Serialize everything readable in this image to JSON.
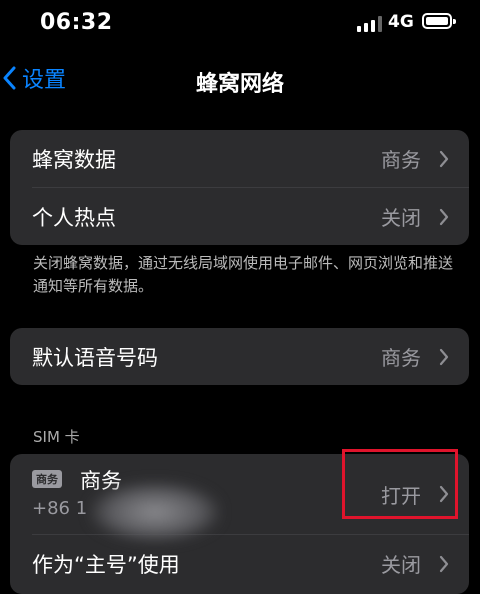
{
  "status_bar": {
    "time": "06:32",
    "network": "4G"
  },
  "nav": {
    "back_label": "设置",
    "title": "蜂窝网络"
  },
  "group1": {
    "rows": [
      {
        "label": "蜂窝数据",
        "value": "商务"
      },
      {
        "label": "个人热点",
        "value": "关闭"
      }
    ]
  },
  "footnote": "关闭蜂窝数据，通过无线局域网使用电子邮件、网页浏览和推送通知等所有数据。",
  "group2": {
    "rows": [
      {
        "label": "默认语音号码",
        "value": "商务"
      }
    ]
  },
  "sim_section": {
    "header": "SIM 卡",
    "sim": {
      "badge": "商务",
      "name": "商务",
      "number": "+86 1",
      "value": "打开"
    },
    "primary_row": {
      "label": "作为“主号”使用",
      "value": "关闭"
    }
  },
  "colors": {
    "accent": "#0a84ff",
    "highlight": "#e0142c",
    "cell_bg": "#2c2c2e"
  },
  "icons": [
    "chevron-left-icon",
    "chevron-right-icon",
    "signal-icon",
    "battery-icon"
  ]
}
